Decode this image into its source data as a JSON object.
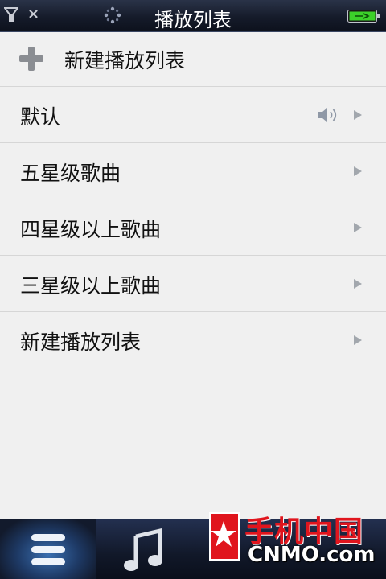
{
  "header": {
    "title": "播放列表",
    "close_glyph": "×",
    "icons": [
      "signal-icon",
      "close-icon",
      "spinner-icon",
      "battery-icon"
    ]
  },
  "list": {
    "new_playlist_label": "新建播放列表",
    "items": [
      {
        "label": "默认",
        "now_playing": true
      },
      {
        "label": "五星级歌曲"
      },
      {
        "label": "四星级以上歌曲"
      },
      {
        "label": "三星级以上歌曲"
      },
      {
        "label": "新建播放列表"
      }
    ]
  },
  "bottom_tabs": [
    {
      "name": "playlist",
      "icon": "list-icon",
      "active": true
    },
    {
      "name": "music",
      "icon": "music-note-icon",
      "active": false
    }
  ],
  "watermark": {
    "brand_cn": "手机中国",
    "brand_en": "CNMO.com"
  },
  "colors": {
    "accent_blue": "#3a6fb0",
    "battery_green": "#3cd12a",
    "watermark_red": "#e0151d"
  }
}
